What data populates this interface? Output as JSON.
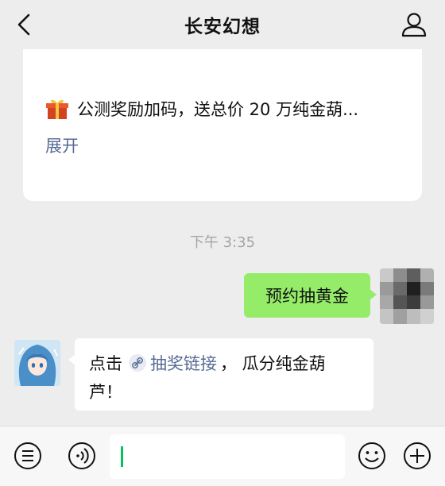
{
  "header": {
    "title": "长安幻想"
  },
  "card": {
    "text": "公测奖励加码，送总价 20 万纯金葫...",
    "expand": "展开"
  },
  "timestamp": "下午 3:35",
  "messages": {
    "me": {
      "text": "预约抽黄金"
    },
    "other": {
      "prefix": "点击",
      "link": "抽奖链接",
      "suffix": "， 瓜分纯金葫",
      "line2": "芦！"
    }
  },
  "icons": [
    "back-icon",
    "profile-icon",
    "gift-icon",
    "link-icon",
    "menu-icon",
    "voice-icon",
    "emoji-icon",
    "plus-icon"
  ],
  "colors": {
    "background": "#ededed",
    "bubble_me": "#95ec69",
    "link": "#576b95",
    "cursor": "#07c160"
  }
}
